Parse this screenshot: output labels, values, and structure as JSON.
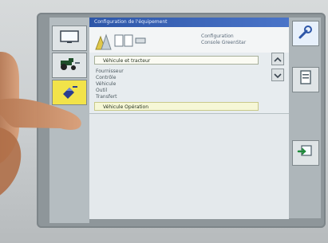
{
  "window": {
    "title": "Configuration de l'équipement"
  },
  "header": {
    "info_line_1": "Configuration",
    "info_line_2": "Console GreenStar"
  },
  "list": {
    "selected_item": "Véhicule et tracteur",
    "items": [
      "Fournisseur",
      "Contrôle",
      "Véhicule",
      "Outil",
      "Transfert"
    ],
    "field_2": "Véhicule Opération"
  },
  "icons": {
    "left": [
      "display-icon",
      "tractor-icon",
      "satellite-icon"
    ],
    "right": [
      "wrench-icon",
      "document-icon",
      "enter-icon"
    ]
  },
  "colors": {
    "title_bar": "#2d56a8",
    "active_button": "#f2e34a"
  }
}
